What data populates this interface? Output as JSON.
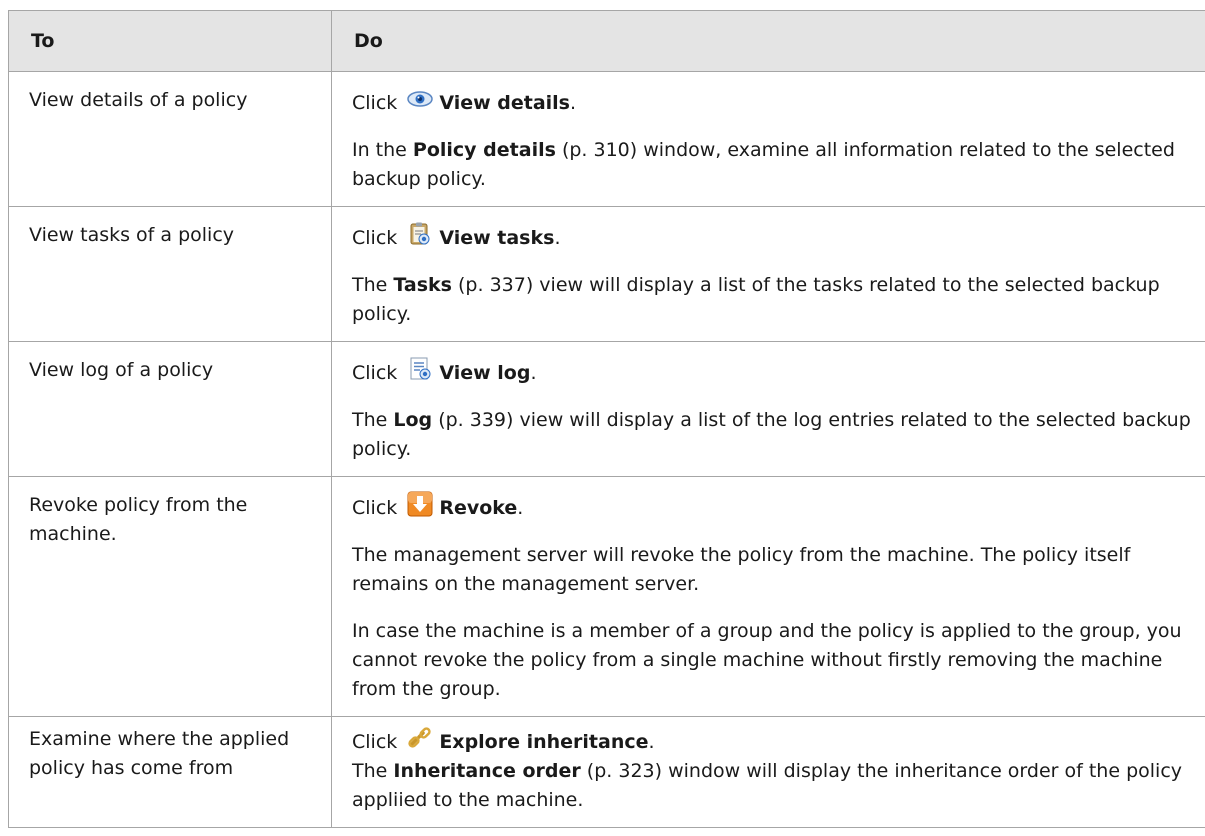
{
  "header": {
    "col1": "To",
    "col2": "Do"
  },
  "rows": [
    {
      "to": "View details of a policy",
      "click_prefix": "Click",
      "icon": "eye-icon",
      "action": "View details",
      "paras": [
        {
          "pre": "In the ",
          "bold": "Policy details",
          "ref": " (p. 310)",
          "post": " window, examine all information related to the selected backup policy."
        }
      ]
    },
    {
      "to": "View tasks of a policy",
      "click_prefix": "Click",
      "icon": "tasks-clipboard-icon",
      "action": "View tasks",
      "paras": [
        {
          "pre": "The ",
          "bold": "Tasks",
          "ref": " (p. 337)",
          "post": " view will display a list of the tasks related to the selected backup policy."
        }
      ]
    },
    {
      "to": "View log of a policy",
      "click_prefix": "Click",
      "icon": "log-document-icon",
      "action": "View log",
      "paras": [
        {
          "pre": "The ",
          "bold": "Log",
          "ref": " (p. 339)",
          "post": " view will display a list of the log entries related to the selected backup policy."
        }
      ]
    },
    {
      "to": "Revoke policy from the machine.",
      "click_prefix": "Click",
      "icon": "revoke-arrow-icon",
      "action": "Revoke",
      "paras": [
        {
          "text": "The management server will revoke the policy from the machine. The policy itself remains on the management server."
        },
        {
          "text": "In case the machine is a member of a group and the policy is applied to the group, you cannot revoke the policy from a single machine without firstly removing the machine from the group."
        }
      ]
    },
    {
      "to": "Examine where the applied policy has come from",
      "click_prefix": "Click",
      "icon": "chain-link-icon",
      "action": "Explore inheritance",
      "paras": [
        {
          "pre": "The ",
          "bold": "Inheritance order",
          "ref": " (p. 323)",
          "post": " window will display the inheritance order of the policy appliied to the machine."
        }
      ]
    }
  ]
}
